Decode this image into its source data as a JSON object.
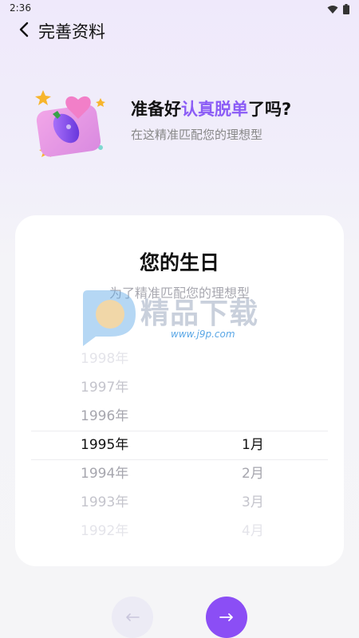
{
  "status_bar": {
    "time": "2:36",
    "icons": [
      "wifi-icon",
      "battery-icon"
    ]
  },
  "header": {
    "title": "完善资料",
    "back_icon": "chevron-left-icon"
  },
  "hero": {
    "title_before": "准备好",
    "title_highlight": "认真脱单",
    "title_after": "了吗?",
    "subtitle": "在这精准匹配您的理想型",
    "illustration": "eggplant-envelope-icon"
  },
  "card": {
    "title": "您的生日",
    "subtitle": "为了精准匹配您的理想型",
    "years": [
      "1998年",
      "1997年",
      "1996年",
      "1995年",
      "1994年",
      "1993年",
      "1992年"
    ],
    "selected_year": "1995年",
    "months": [
      "1月",
      "2月",
      "3月",
      "4月"
    ],
    "selected_month": "1月"
  },
  "watermark": {
    "text": "精品下载",
    "url": "www.j9p.com"
  },
  "nav": {
    "prev_icon": "arrow-left-icon",
    "next_icon": "arrow-right-icon"
  },
  "colors": {
    "accent": "#8b4ef5",
    "highlight": "#8b5cf6",
    "muted": "#a8a8b0"
  }
}
